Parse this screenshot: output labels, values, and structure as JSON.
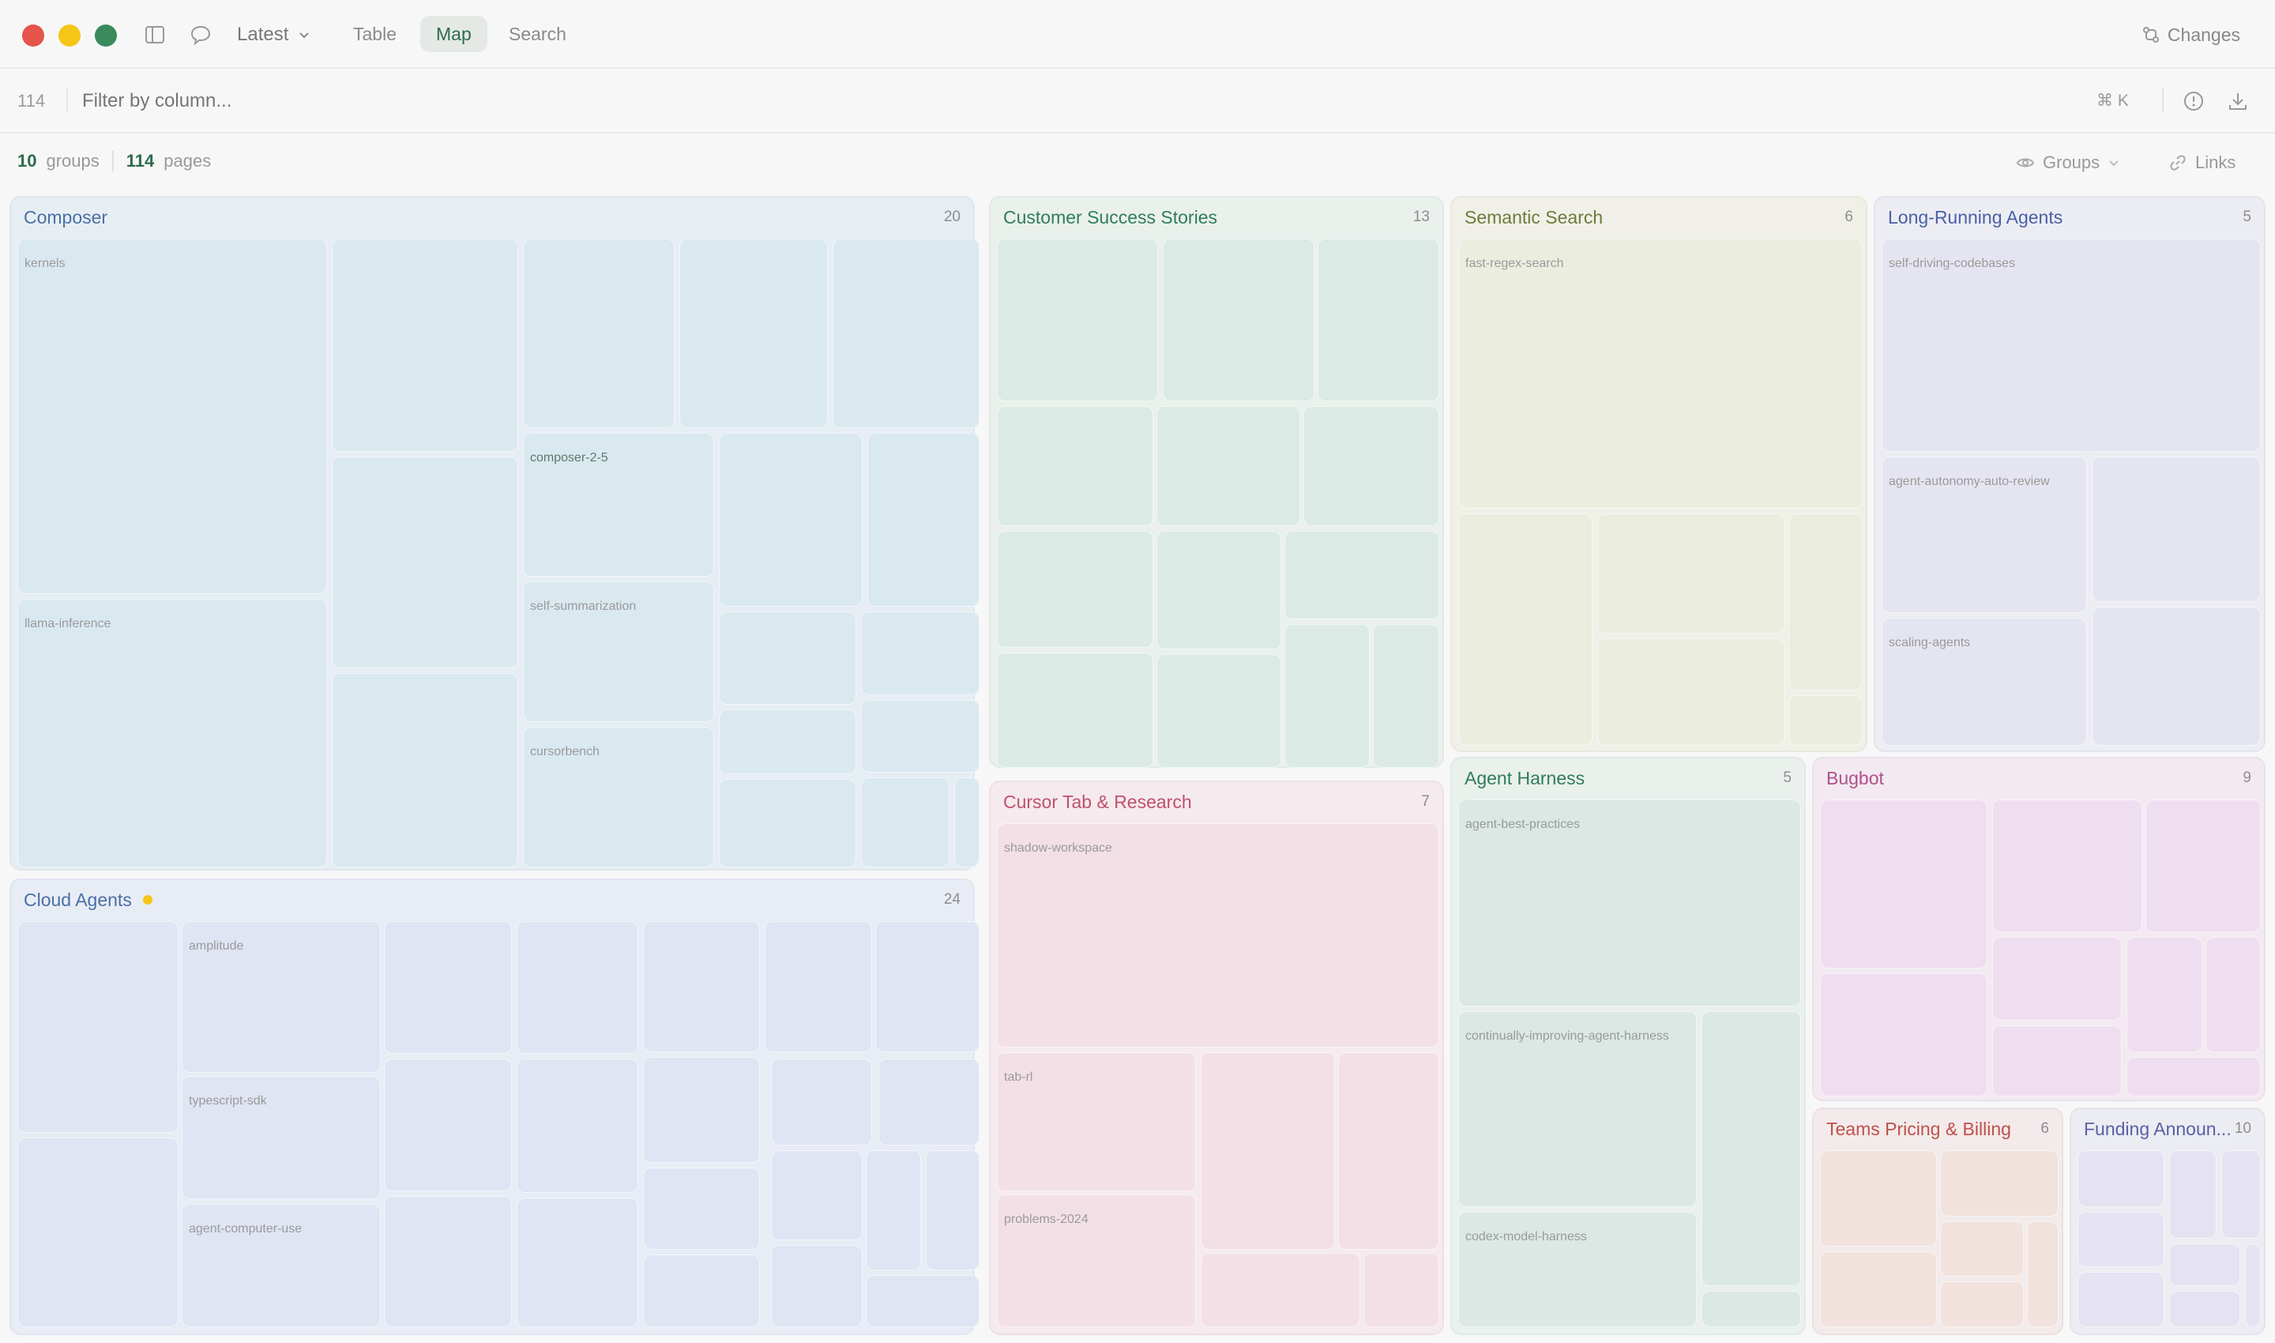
{
  "window": {
    "traffic_lights": [
      "#e5534b",
      "#f5c518",
      "#3a8a5c"
    ]
  },
  "toolbar": {
    "version_label": "Latest",
    "tabs": [
      {
        "label": "Table"
      },
      {
        "label": "Map"
      },
      {
        "label": "Search"
      }
    ],
    "active_tab": "Map",
    "changes_label": "Changes"
  },
  "filter": {
    "count": "114",
    "placeholder": "Filter by column...",
    "shortcut": "⌘ K"
  },
  "stats": {
    "groups_count": "10",
    "groups_label": "groups",
    "pages_count": "114",
    "pages_label": "pages",
    "groups_toggle": "Groups",
    "links_label": "Links"
  },
  "groups": [
    {
      "name": "Composer",
      "count": "20",
      "color": "#4a6fa5",
      "labels": [
        "kernels",
        "llama-inference",
        "composer-2-5",
        "self-summarization",
        "cursorbench"
      ]
    },
    {
      "name": "Cloud Agents",
      "count": "24",
      "color": "#4a6fa5",
      "labels": [
        "amplitude",
        "typescript-sdk",
        "agent-computer-use"
      ]
    },
    {
      "name": "Customer Success Stories",
      "count": "13",
      "color": "#2e7d5b",
      "labels": []
    },
    {
      "name": "Cursor Tab & Research",
      "count": "7",
      "color": "#c0506e",
      "labels": [
        "shadow-workspace",
        "tab-rl",
        "problems-2024"
      ]
    },
    {
      "name": "Semantic Search",
      "count": "6",
      "color": "#6e7a3a",
      "labels": [
        "fast-regex-search"
      ]
    },
    {
      "name": "Long-Running Agents",
      "count": "5",
      "color": "#4a5fa5",
      "labels": [
        "self-driving-codebases",
        "agent-autonomy-auto-review",
        "scaling-agents"
      ]
    },
    {
      "name": "Agent Harness",
      "count": "5",
      "color": "#2e7d5b",
      "labels": [
        "agent-best-practices",
        "continually-improving-agent-harness",
        "codex-model-harness"
      ]
    },
    {
      "name": "Bugbot",
      "count": "9",
      "color": "#b0508a",
      "labels": []
    },
    {
      "name": "Teams Pricing & Billing",
      "count": "6",
      "color": "#c0504a",
      "labels": []
    },
    {
      "name": "Funding Announ...",
      "count": "10",
      "color": "#5a5fa5",
      "labels": []
    }
  ]
}
